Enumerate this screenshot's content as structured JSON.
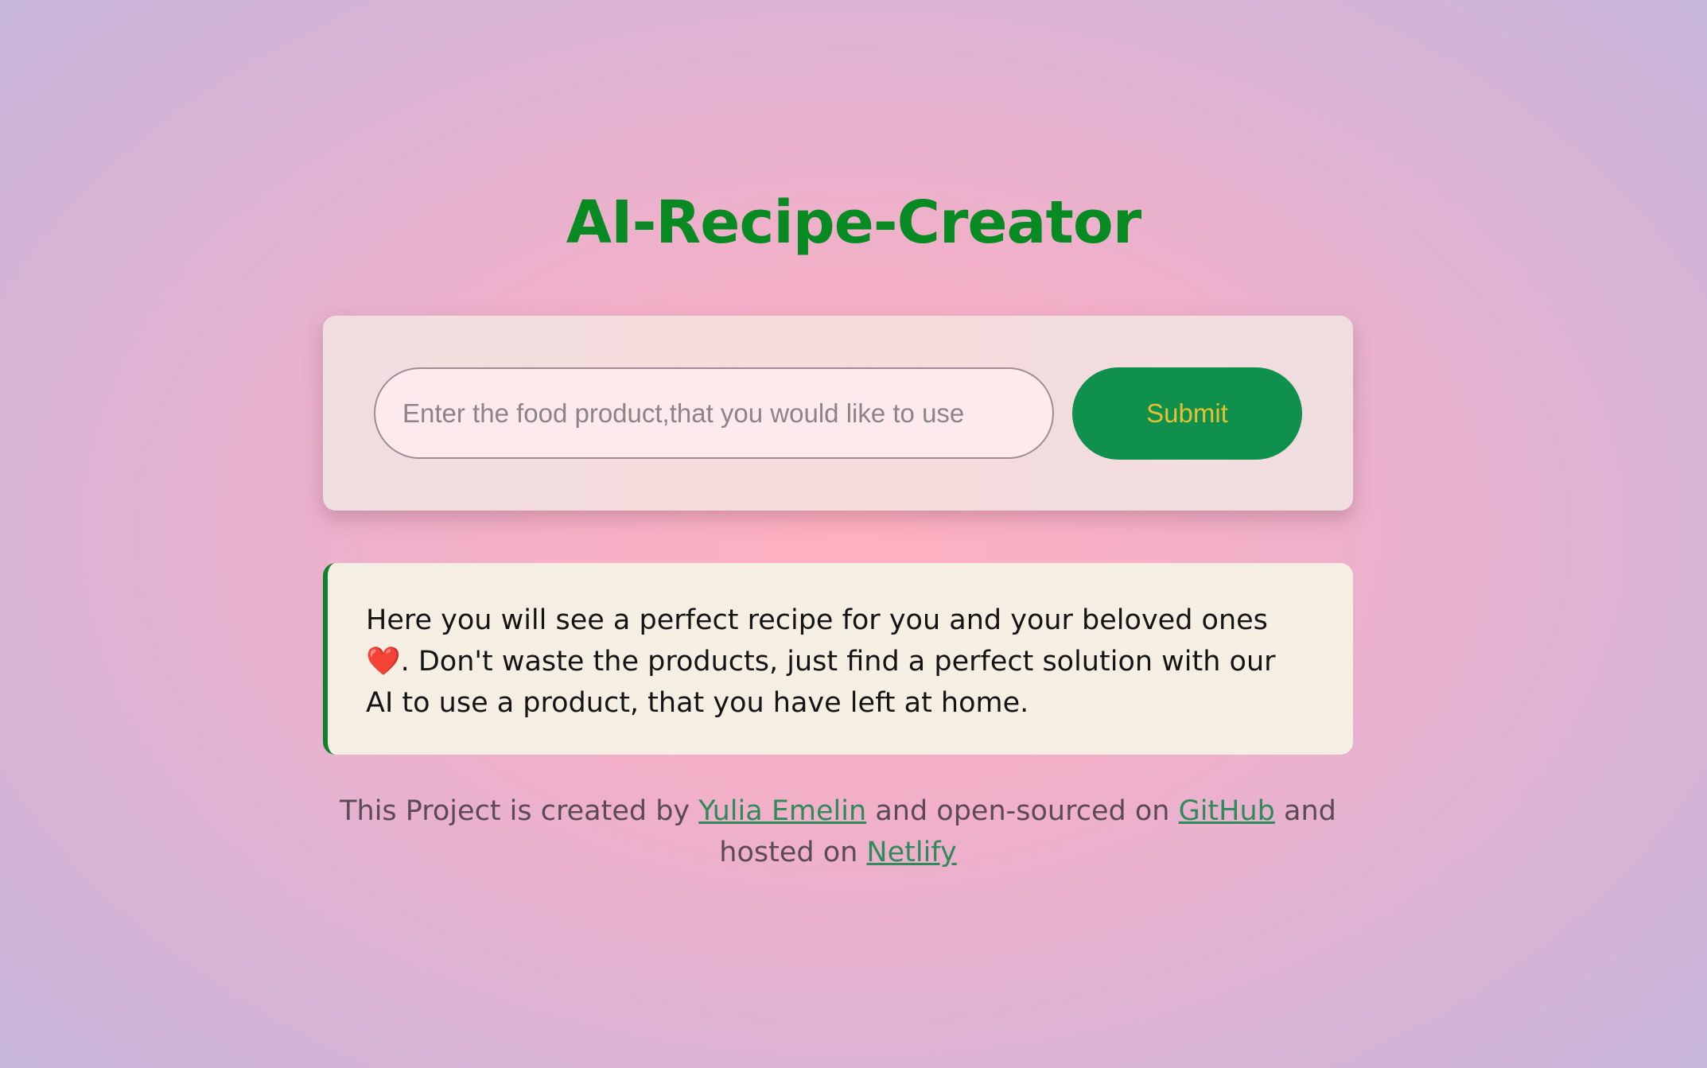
{
  "app": {
    "title": "AI-Recipe-Creator"
  },
  "form": {
    "input_placeholder": "Enter the food product,that you would like to use",
    "input_value": "",
    "submit_label": "Submit"
  },
  "recipe": {
    "text_before_icon": "Here you will see a perfect recipe for you and your beloved ones",
    "icon": "heart-icon",
    "icon_glyph": "❤️",
    "text_after_icon": ". Don't waste the products, just find a perfect solution with our AI to use a product, that you have left at home."
  },
  "footer": {
    "text_1": "This Project is created by ",
    "author_link": "Yulia Emelin",
    "text_2": " and open-sourced on ",
    "github_link": "GitHub",
    "text_3": " and hosted on ",
    "netlify_link": "Netlify"
  },
  "colors": {
    "title_green": "#088a23",
    "button_bg": "#10904d",
    "button_text": "#e5c02f",
    "link_green": "#2f8a5c",
    "accent_border": "#0f7f2e"
  }
}
